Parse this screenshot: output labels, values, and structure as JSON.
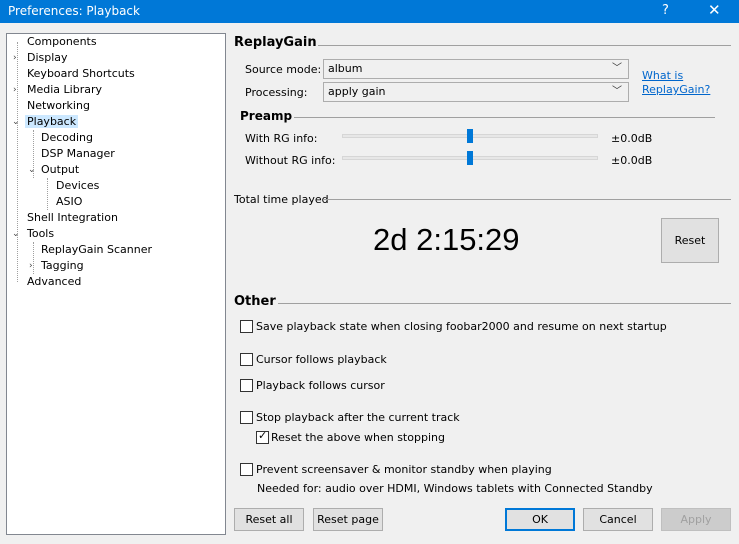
{
  "window": {
    "title": "Preferences: Playback",
    "help_glyph": "?",
    "close_glyph": "✕"
  },
  "tree": {
    "items": [
      {
        "label": "Components"
      },
      {
        "label": "Display"
      },
      {
        "label": "Keyboard Shortcuts"
      },
      {
        "label": "Media Library"
      },
      {
        "label": "Networking"
      },
      {
        "label": "Playback"
      },
      {
        "label": "Decoding"
      },
      {
        "label": "DSP Manager"
      },
      {
        "label": "Output"
      },
      {
        "label": "Devices"
      },
      {
        "label": "ASIO"
      },
      {
        "label": "Shell Integration"
      },
      {
        "label": "Tools"
      },
      {
        "label": "ReplayGain Scanner"
      },
      {
        "label": "Tagging"
      },
      {
        "label": "Advanced"
      }
    ],
    "selected": "Playback"
  },
  "replaygain": {
    "title": "ReplayGain",
    "source_mode_label": "Source mode:",
    "source_mode_value": "album",
    "processing_label": "Processing:",
    "processing_value": "apply gain",
    "help_link_line1": "What is",
    "help_link_line2": "ReplayGain?"
  },
  "preamp": {
    "title": "Preamp",
    "with_rg_label": "With RG info:",
    "with_rg_value": "±0.0dB",
    "with_rg_level": 0.5,
    "without_rg_label": "Without RG info:",
    "without_rg_value": "±0.0dB",
    "without_rg_level": 0.5
  },
  "total_time": {
    "label": "Total time played",
    "value": "2d 2:15:29",
    "reset_label": "Reset"
  },
  "other": {
    "title": "Other",
    "save_state": {
      "label": "Save playback state when closing foobar2000 and resume on next startup",
      "checked": false
    },
    "cursor_follows": {
      "label": "Cursor follows playback",
      "checked": false
    },
    "playback_follows": {
      "label": "Playback follows cursor",
      "checked": false
    },
    "stop_after": {
      "label": "Stop playback after the current track",
      "checked": false
    },
    "reset_above": {
      "label": "Reset the above when stopping",
      "checked": true
    },
    "prevent_screensaver": {
      "label": "Prevent screensaver & monitor standby when playing",
      "checked": false
    },
    "needed_for": "Needed for: audio over HDMI, Windows tablets with Connected Standby"
  },
  "buttons": {
    "reset_all": "Reset all",
    "reset_page": "Reset page",
    "ok": "OK",
    "cancel": "Cancel",
    "apply": "Apply"
  },
  "colors": {
    "accent": "#0078d7",
    "selection": "#cce8ff",
    "link": "#0066cc"
  }
}
